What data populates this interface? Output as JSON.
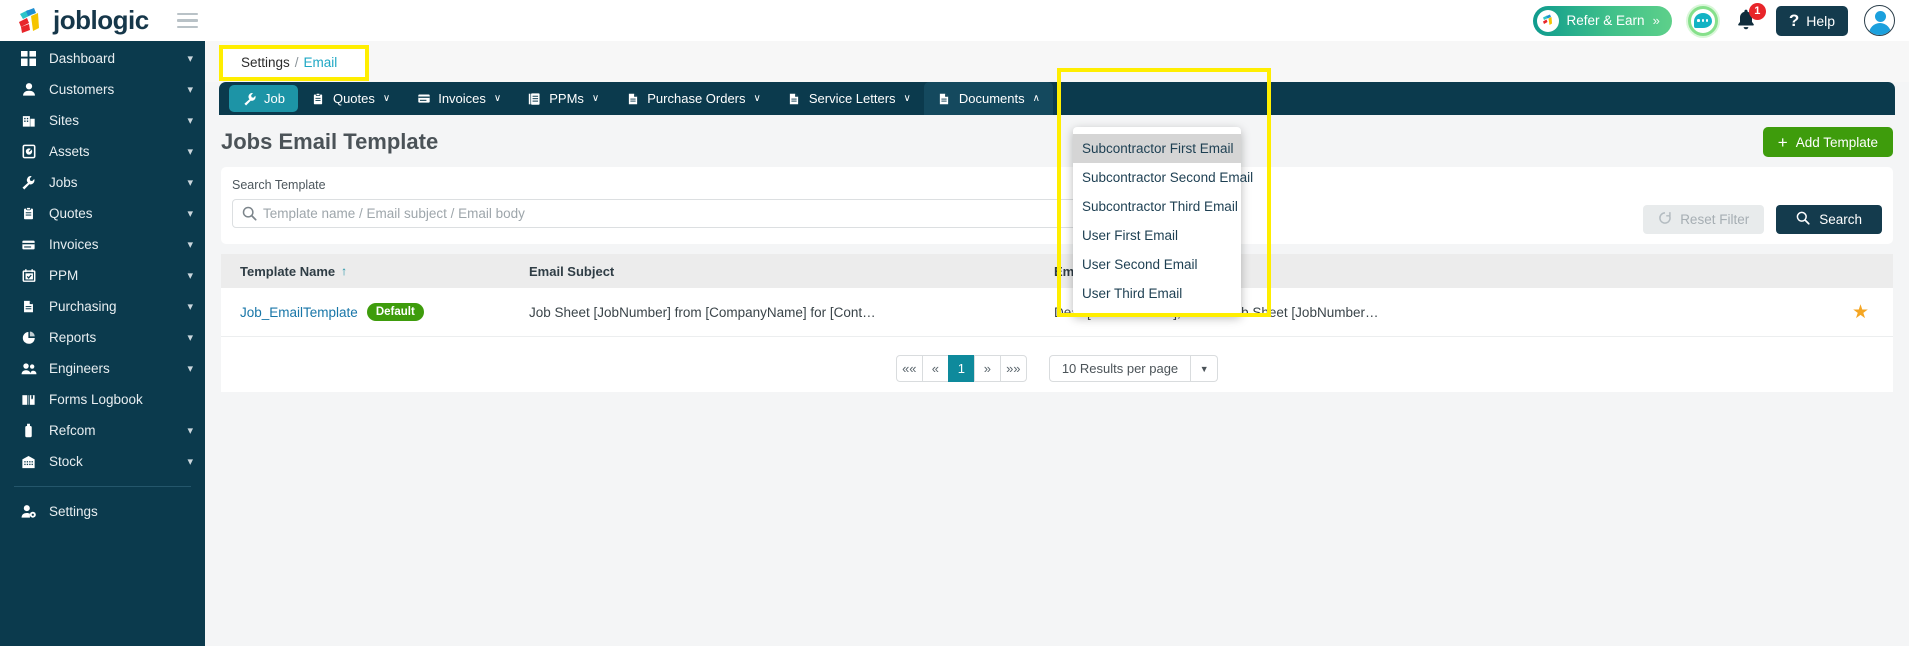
{
  "header": {
    "brand": "joblogic",
    "menu_icon": "hamburger-icon",
    "refer_label": "Refer & Earn",
    "refer_chevron": "»",
    "notification_count": "1",
    "help_label": "Help",
    "help_icon": "question-mark-icon"
  },
  "sidebar": {
    "items": [
      {
        "label": "Dashboard",
        "icon": "dashboard-icon",
        "chevron": true
      },
      {
        "label": "Customers",
        "icon": "user-icon",
        "chevron": true
      },
      {
        "label": "Sites",
        "icon": "building-icon",
        "chevron": true
      },
      {
        "label": "Assets",
        "icon": "asset-icon",
        "chevron": true
      },
      {
        "label": "Jobs",
        "icon": "wrench-icon",
        "chevron": true
      },
      {
        "label": "Quotes",
        "icon": "clipboard-icon",
        "chevron": true
      },
      {
        "label": "Invoices",
        "icon": "invoice-icon",
        "chevron": true
      },
      {
        "label": "PPM",
        "icon": "calendar-icon",
        "chevron": true
      },
      {
        "label": "Purchasing",
        "icon": "document-icon",
        "chevron": true
      },
      {
        "label": "Reports",
        "icon": "pie-chart-icon",
        "chevron": true
      },
      {
        "label": "Engineers",
        "icon": "users-icon",
        "chevron": true
      },
      {
        "label": "Forms Logbook",
        "icon": "book-icon",
        "chevron": false
      },
      {
        "label": "Refcom",
        "icon": "cylinder-icon",
        "chevron": true
      },
      {
        "label": "Stock",
        "icon": "warehouse-icon",
        "chevron": true
      }
    ],
    "footer_item": {
      "label": "Settings",
      "icon": "settings-user-icon"
    }
  },
  "breadcrumb": {
    "root": "Settings",
    "separator": "/",
    "current": "Email"
  },
  "tabs": [
    {
      "label": "Job",
      "icon": "wrench-icon",
      "active": true,
      "caret": ""
    },
    {
      "label": "Quotes",
      "icon": "clipboard-icon",
      "active": false,
      "caret": "∨"
    },
    {
      "label": "Invoices",
      "icon": "invoice-icon",
      "active": false,
      "caret": "∨"
    },
    {
      "label": "PPMs",
      "icon": "ppm-icon",
      "active": false,
      "caret": "∨"
    },
    {
      "label": "Purchase Orders",
      "icon": "document-icon",
      "active": false,
      "caret": "∨"
    },
    {
      "label": "Service Letters",
      "icon": "document-icon",
      "active": false,
      "caret": "∨"
    },
    {
      "label": "Documents",
      "icon": "document-icon",
      "active": false,
      "caret": "∧",
      "open": true
    }
  ],
  "documents_dropdown": {
    "open": true,
    "items": [
      {
        "label": "Subcontractor First Email",
        "highlighted": true
      },
      {
        "label": "Subcontractor Second Email",
        "highlighted": false
      },
      {
        "label": "Subcontractor Third Email",
        "highlighted": false
      },
      {
        "label": "User First Email",
        "highlighted": false
      },
      {
        "label": "User Second Email",
        "highlighted": false
      },
      {
        "label": "User Third Email",
        "highlighted": false
      }
    ]
  },
  "page": {
    "title": "Jobs Email Template",
    "add_button": "Add Template",
    "add_button_icon": "plus-icon"
  },
  "filter": {
    "search_label": "Search Template",
    "search_placeholder": "Template name / Email subject / Email body",
    "search_value": "",
    "search_icon": "search-icon",
    "reset_label": "Reset Filter",
    "reset_icon": "refresh-icon",
    "search_button": "Search",
    "search_button_icon": "search-icon"
  },
  "table": {
    "columns": [
      "Template Name",
      "Email Subject",
      "Email Body"
    ],
    "sort_indicator": "↑",
    "rows": [
      {
        "name": "Job_EmailTemplate",
        "badge": "Default",
        "subject": "Job Sheet [JobNumber] from [CompanyName] for [Cont…",
        "body": "Dear [ContactName], Here's Job Sheet [JobNumber…",
        "starred": true,
        "star_icon": "star-icon"
      }
    ]
  },
  "pagination": {
    "first": "««",
    "prev": "«",
    "pages": [
      "1"
    ],
    "current_page": "1",
    "next": "»",
    "last": "»»",
    "per_page": "10 Results per page",
    "per_page_caret": "▼"
  },
  "colors": {
    "sidebar_bg": "#0b3a4d",
    "tab_active": "#1d94a6",
    "accent_green": "#3e9c0c",
    "link": "#1876a8",
    "highlight_yellow": "#ffee00",
    "badge_red": "#e8252a",
    "star_gold": "#f5a623"
  }
}
